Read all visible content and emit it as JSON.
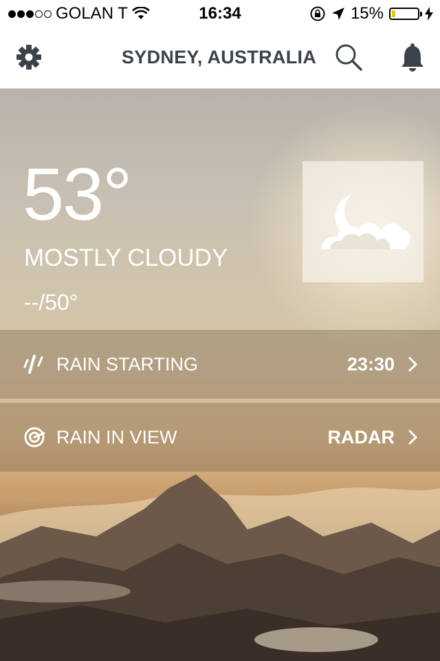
{
  "status_bar": {
    "carrier": "GOLAN T",
    "time": "16:34",
    "battery_percent": "15%",
    "battery_level": 0.15
  },
  "header": {
    "location": "SYDNEY, AUSTRALIA",
    "icons": [
      "gear-icon",
      "search-icon",
      "bell-icon"
    ]
  },
  "current": {
    "temperature": "53°",
    "condition": "MOSTLY CLOUDY",
    "hi_lo": "--/50°",
    "condition_icon": "moon-cloud-icon"
  },
  "rows": [
    {
      "icon": "rain-icon",
      "label": "RAIN STARTING",
      "value": "23:30"
    },
    {
      "icon": "radar-icon",
      "label": "RAIN IN VIEW",
      "value": "RADAR"
    }
  ],
  "colors": {
    "header_text": "#3b4249",
    "battery_fill": "#f5c400"
  }
}
